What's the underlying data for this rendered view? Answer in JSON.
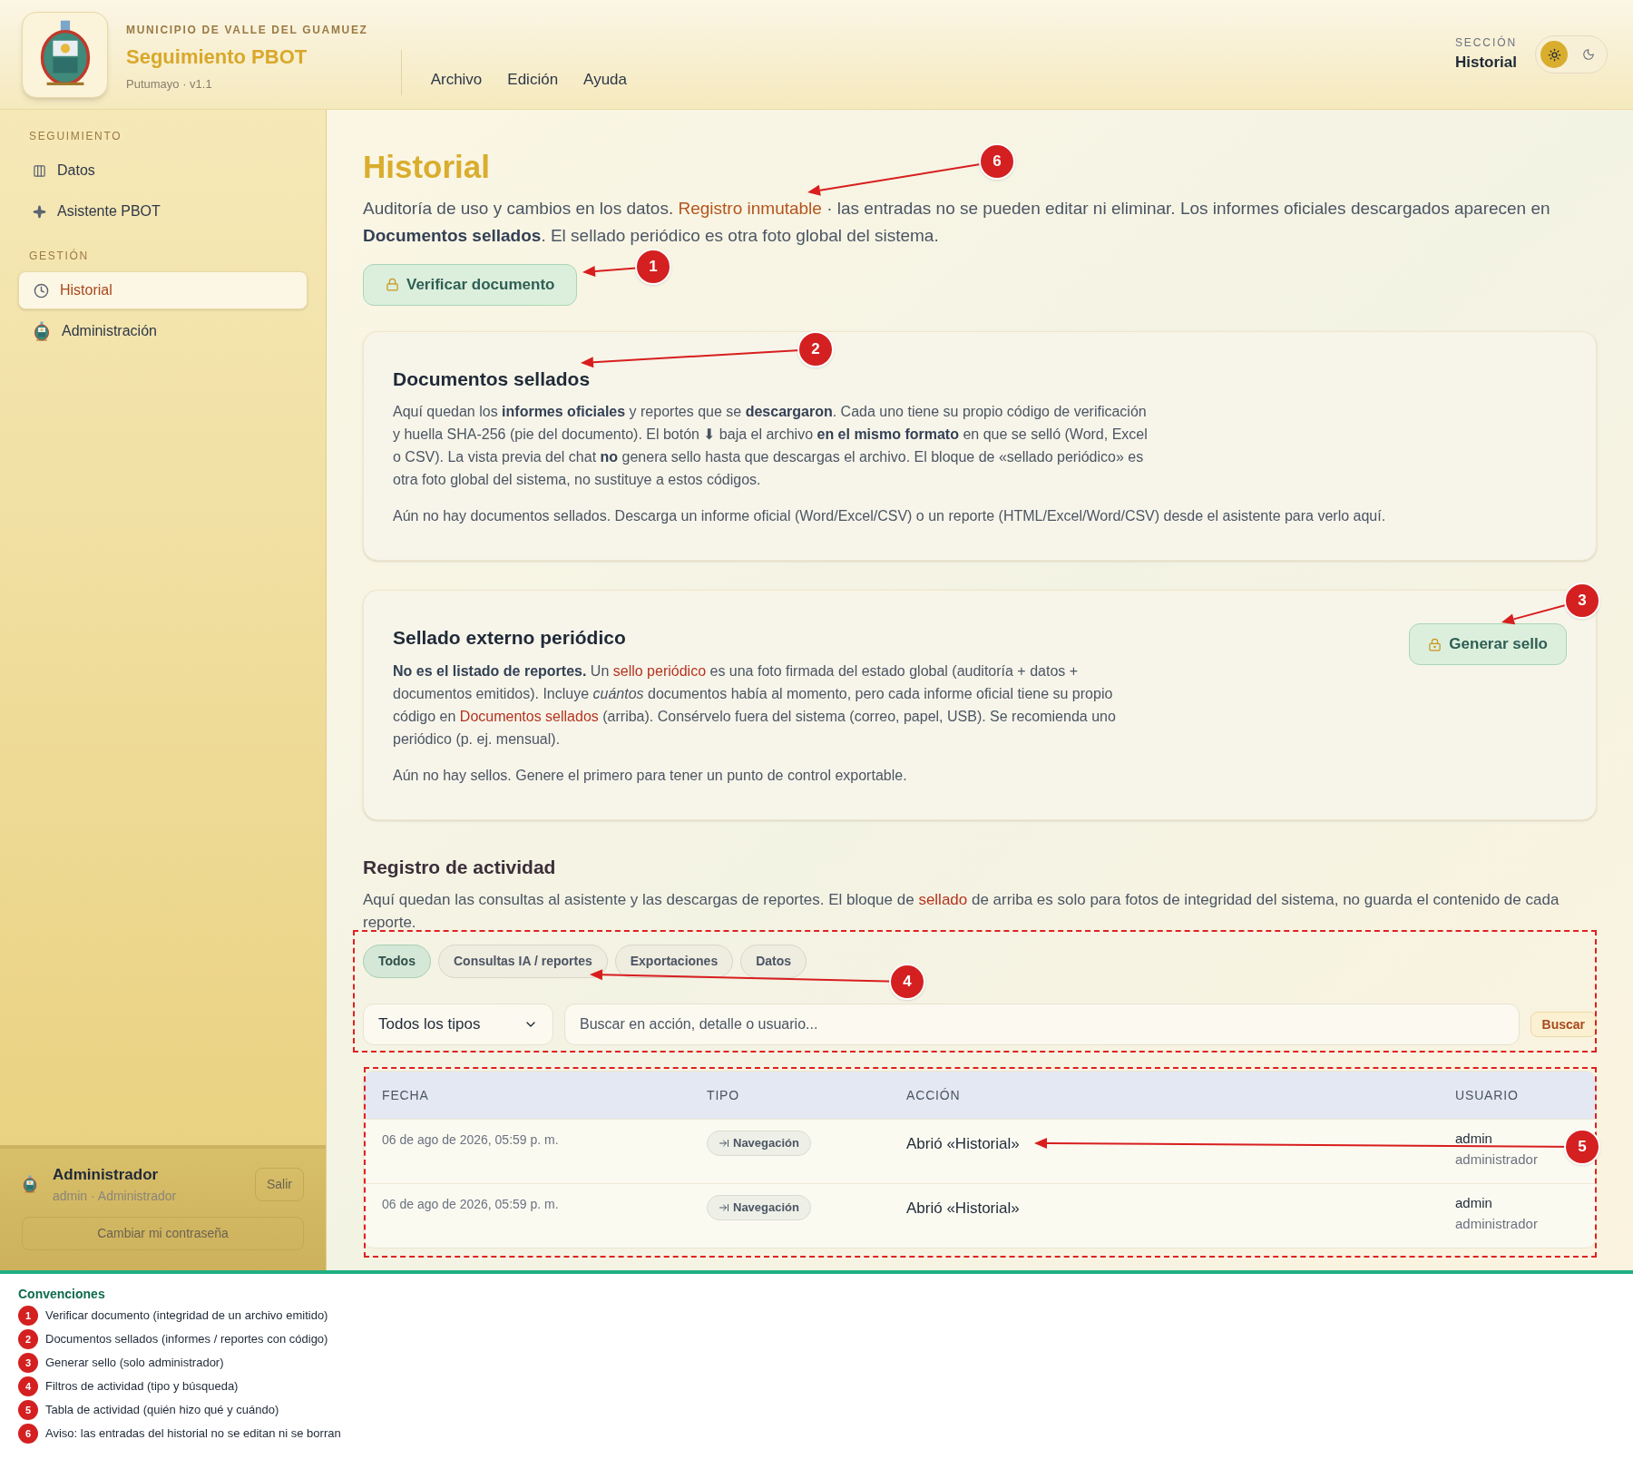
{
  "header": {
    "municipality": "MUNICIPIO DE VALLE DEL GUAMUEZ",
    "app_title": "Seguimiento PBOT",
    "subtitle": "Putumayo · v1.1",
    "menu": [
      "Archivo",
      "Edición",
      "Ayuda"
    ],
    "section_label": "SECCIÓN",
    "section_value": "Historial",
    "theme": [
      {
        "kind": "sun",
        "selected": true
      },
      {
        "kind": "moon",
        "selected": false
      }
    ]
  },
  "sidebar": {
    "groups": [
      {
        "heading": "SEGUIMIENTO",
        "items": [
          {
            "label": "Datos",
            "selected": false
          },
          {
            "label": "Asistente PBOT",
            "selected": false
          }
        ]
      },
      {
        "heading": "GESTIÓN",
        "items": [
          {
            "label": "Historial",
            "selected": true
          },
          {
            "label": "Administración",
            "selected": false
          }
        ]
      }
    ],
    "user": {
      "name": "Administrador",
      "detail": "admin · Administrador",
      "logout": "Salir",
      "change_password": "Cambiar mi contraseña"
    }
  },
  "page": {
    "title": "Historial",
    "intro": [
      {
        "kind": "plain",
        "text": "Auditoría de uso y cambios en los datos. "
      },
      {
        "kind": "accent",
        "text": "Registro inmutable"
      },
      {
        "kind": "plain",
        "text": " · las entradas no se pueden editar ni eliminar. Los informes oficiales descargados aparecen en "
      },
      {
        "kind": "bold",
        "text": "Documentos sellados"
      },
      {
        "kind": "plain",
        "text": ". El sellado periódico es otra foto global del sistema."
      }
    ],
    "verify_button": "Verificar documento",
    "cards": [
      {
        "title": "Documentos sellados",
        "body": [
          {
            "kind": "plain",
            "text": "Aquí quedan los "
          },
          {
            "kind": "bold",
            "text": "informes oficiales"
          },
          {
            "kind": "plain",
            "text": " y reportes que se "
          },
          {
            "kind": "bold",
            "text": "descargaron"
          },
          {
            "kind": "plain",
            "text": ". Cada uno tiene su propio código de verificación y huella SHA-256 (pie del documento). El botón ⬇ baja el archivo "
          },
          {
            "kind": "bold",
            "text": "en el mismo formato"
          },
          {
            "kind": "plain",
            "text": " en que se selló (Word, Excel o CSV). La vista previa del chat "
          },
          {
            "kind": "bold",
            "text": "no"
          },
          {
            "kind": "plain",
            "text": " genera sello hasta que descargas el archivo. El bloque de «sellado periódico» es otra foto global del sistema, no sustituye a estos códigos."
          }
        ],
        "empty": "Aún no hay documentos sellados. Descarga un informe oficial (Word/Excel/CSV) o un reporte (HTML/Excel/Word/CSV) desde el asistente para verlo aquí."
      },
      {
        "title": "Sellado externo periódico",
        "button": "Generar sello",
        "body": [
          {
            "kind": "bold",
            "text": "No es el listado de reportes."
          },
          {
            "kind": "plain",
            "text": " Un "
          },
          {
            "kind": "accent",
            "text": "sello periódico"
          },
          {
            "kind": "plain",
            "text": " es una foto firmada del estado global (auditoría + datos + documentos emitidos). Incluye "
          },
          {
            "kind": "italic",
            "text": "cuántos"
          },
          {
            "kind": "plain",
            "text": " documentos había al momento, pero cada informe oficial tiene su propio código en "
          },
          {
            "kind": "accent",
            "text": "Documentos sellados"
          },
          {
            "kind": "plain",
            "text": " (arriba). Consérvelo fuera del sistema (correo, papel, USB). Se recomienda uno periódico (p. ej. mensual)."
          }
        ],
        "empty": "Aún no hay sellos. Genere el primero para tener un punto de control exportable."
      }
    ],
    "activity": {
      "title": "Registro de actividad",
      "description": [
        {
          "kind": "plain",
          "text": "Aquí quedan las consultas al asistente y las descargas de reportes. El bloque de "
        },
        {
          "kind": "accent",
          "text": "sellado"
        },
        {
          "kind": "plain",
          "text": " de arriba es solo para fotos de integridad del sistema, no guarda el contenido de cada reporte."
        }
      ],
      "filters": [
        {
          "label": "Todos",
          "selected": true
        },
        {
          "label": "Consultas IA / reportes",
          "selected": false
        },
        {
          "label": "Exportaciones",
          "selected": false
        },
        {
          "label": "Datos",
          "selected": false
        }
      ],
      "type_select": "Todos los tipos",
      "search": {
        "placeholder": "Buscar en acción, detalle o usuario..."
      },
      "search_button": "Buscar",
      "table": {
        "columns": [
          "FECHA",
          "TIPO",
          "ACCIÓN",
          "USUARIO"
        ],
        "rows": [
          {
            "date": "06 de ago de 2026, 05:59 p. m.",
            "type": "Navegación",
            "action": "Abrió «Historial»",
            "user": "admin",
            "role": "administrador"
          },
          {
            "date": "06 de ago de 2026, 05:59 p. m.",
            "type": "Navegación",
            "action": "Abrió «Historial»",
            "user": "admin",
            "role": "administrador"
          }
        ]
      }
    }
  },
  "callouts": [
    {
      "number": "1"
    },
    {
      "number": "2"
    },
    {
      "number": "3"
    },
    {
      "number": "4"
    },
    {
      "number": "5"
    },
    {
      "number": "6"
    }
  ],
  "legend": {
    "title": "Convenciones",
    "items": [
      {
        "number": "1",
        "text": "Verificar documento (integridad de un archivo emitido)"
      },
      {
        "number": "2",
        "text": "Documentos sellados (informes / reportes con código)"
      },
      {
        "number": "3",
        "text": "Generar sello (solo administrador)"
      },
      {
        "number": "4",
        "text": "Filtros de actividad (tipo y búsqueda)"
      },
      {
        "number": "5",
        "text": "Tabla de actividad (quién hizo qué y cuándo)"
      },
      {
        "number": "6",
        "text": "Aviso: las entradas del historial no se editan ni se borran"
      }
    ]
  }
}
